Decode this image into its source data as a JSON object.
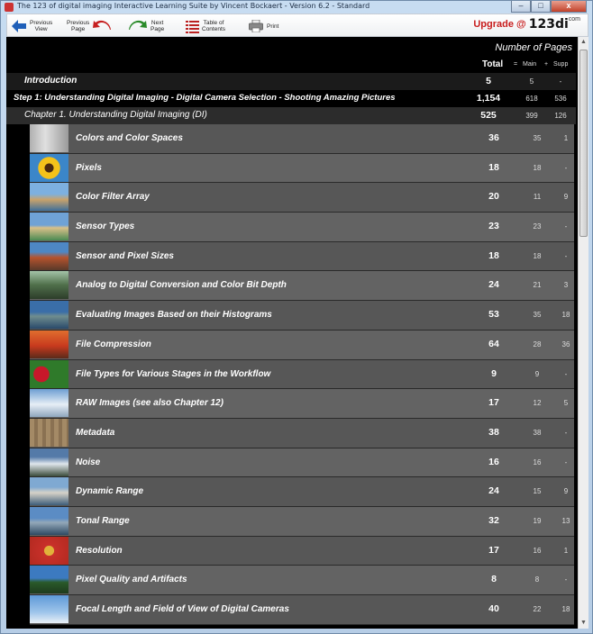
{
  "window": {
    "title": "The 123 of digital imaging Interactive Learning Suite by Vincent Bockaert - Version 6.2 - Standard",
    "minimize": "–",
    "maximize": "□",
    "close": "x"
  },
  "toolbar": {
    "previous_view": "Previous\nView",
    "previous_page": "Previous\nPage",
    "next_page": "Next\nPage",
    "toc": "Table of\nContents",
    "print": "Print",
    "upgrade": "Upgrade @",
    "brand": "123di",
    "brand_suffix": "com"
  },
  "header": {
    "number_of_pages": "Number of Pages",
    "total": "Total",
    "eq": "=",
    "main": "Main",
    "plus": "+",
    "supp": "Supp"
  },
  "intro": {
    "title": "Introduction",
    "total": "5",
    "main": "5",
    "supp": "-"
  },
  "step": {
    "title": "Step 1:  Understanding Digital Imaging - Digital Camera Selection - Shooting Amazing Pictures",
    "total": "1,154",
    "main": "618",
    "supp": "536"
  },
  "chapter": {
    "title": "Chapter   1. Understanding Digital Imaging (DI)",
    "total": "525",
    "main": "399",
    "supp": "126"
  },
  "lessons": [
    {
      "title": "Colors and Color Spaces",
      "total": "36",
      "main": "35",
      "supp": "1"
    },
    {
      "title": "Pixels",
      "total": "18",
      "main": "18",
      "supp": "-"
    },
    {
      "title": "Color Filter Array",
      "total": "20",
      "main": "11",
      "supp": "9"
    },
    {
      "title": "Sensor Types",
      "total": "23",
      "main": "23",
      "supp": "-"
    },
    {
      "title": "Sensor and Pixel Sizes",
      "total": "18",
      "main": "18",
      "supp": "-"
    },
    {
      "title": "Analog to Digital Conversion and Color Bit Depth",
      "total": "24",
      "main": "21",
      "supp": "3"
    },
    {
      "title": "Evaluating Images Based on their Histograms",
      "total": "53",
      "main": "35",
      "supp": "18"
    },
    {
      "title": "File Compression",
      "total": "64",
      "main": "28",
      "supp": "36"
    },
    {
      "title": "File Types for Various Stages in the Workflow",
      "total": "9",
      "main": "9",
      "supp": "-"
    },
    {
      "title": "RAW Images (see also Chapter 12)",
      "total": "17",
      "main": "12",
      "supp": "5"
    },
    {
      "title": "Metadata",
      "total": "38",
      "main": "38",
      "supp": "-"
    },
    {
      "title": "Noise",
      "total": "16",
      "main": "16",
      "supp": "-"
    },
    {
      "title": "Dynamic Range",
      "total": "24",
      "main": "15",
      "supp": "9"
    },
    {
      "title": "Tonal Range",
      "total": "32",
      "main": "19",
      "supp": "13"
    },
    {
      "title": "Resolution",
      "total": "17",
      "main": "16",
      "supp": "1"
    },
    {
      "title": "Pixel Quality and Artifacts",
      "total": "8",
      "main": "8",
      "supp": "-"
    },
    {
      "title": "Focal Length and Field of View of Digital Cameras",
      "total": "40",
      "main": "22",
      "supp": "18"
    }
  ],
  "colors": {
    "content_bg": "#000000",
    "row_odd": "#575757",
    "row_even": "#636363",
    "upgrade_red": "#c81e1e"
  }
}
